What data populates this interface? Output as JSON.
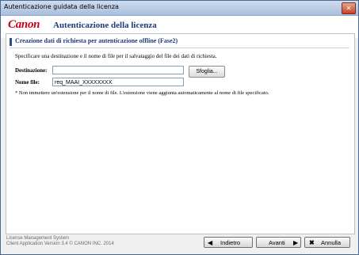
{
  "window": {
    "title": "Autenticazione guidata della licenza",
    "close_glyph": "✕"
  },
  "header": {
    "logo": "Canon",
    "title": "Autenticazione della licenza"
  },
  "section": {
    "title": "Creazione dati di richiesta per autenticazione offline (Fase2)"
  },
  "instruction": "Specificare una destinazione e il nome di file per il salvataggio del file dei dati di richiesta.",
  "fields": {
    "destination": {
      "label": "Destinazione:",
      "value": ""
    },
    "filename": {
      "label": "Nome file:",
      "value": "req_MAAI_XXXXXXXX"
    }
  },
  "browse_label": "Sfoglia...",
  "note": "* Non immettere un'estensione per il nome di file. L'estensione viene aggiunta automaticamente al nome di file specificato.",
  "footer": {
    "line1": "License Management System",
    "line2": "Client Application Version 3.4   © CANON INC. 2014"
  },
  "buttons": {
    "back": {
      "label": "Indietro",
      "icon": "arrow-left-icon"
    },
    "next": {
      "label": "Avanti",
      "icon": "arrow-right-icon"
    },
    "cancel": {
      "label": "Annulla",
      "icon": "close-x-icon"
    }
  }
}
